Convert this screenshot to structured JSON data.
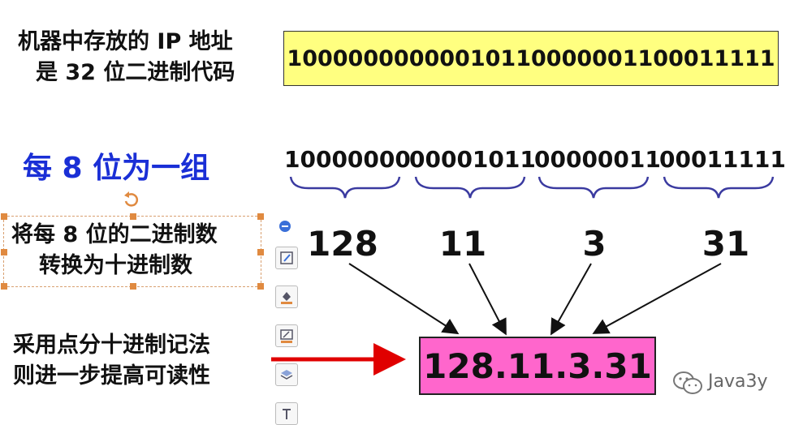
{
  "top_label": {
    "line1": "机器中存放的 IP 地址",
    "line2": "是 32 位二进制代码"
  },
  "binary_full": "10000000000010110000001100011111",
  "group_title": "每 8 位为一组",
  "octets": [
    "10000000",
    "00001011",
    "00000011",
    "00011111"
  ],
  "decimals": [
    "128",
    "11",
    "3",
    "31"
  ],
  "convert_label": {
    "line1": "将每 8 位的二进制数",
    "line2": "转换为十进制数"
  },
  "dotted_label": {
    "line1": "采用点分十进制记法",
    "line2": "则进一步提高可读性"
  },
  "result": "128.11.3.31",
  "watermark": "Java3y",
  "colors": {
    "yellow_box": "#ffff80",
    "pink_box": "#ff66cc",
    "blue_title": "#1a2fd6",
    "brace": "#3a3aa0",
    "red_arrow": "#e00000"
  },
  "toolbar_icons": [
    "collapse-icon",
    "edit-icon",
    "fill-icon",
    "pen-icon",
    "layers-icon",
    "text-icon"
  ]
}
